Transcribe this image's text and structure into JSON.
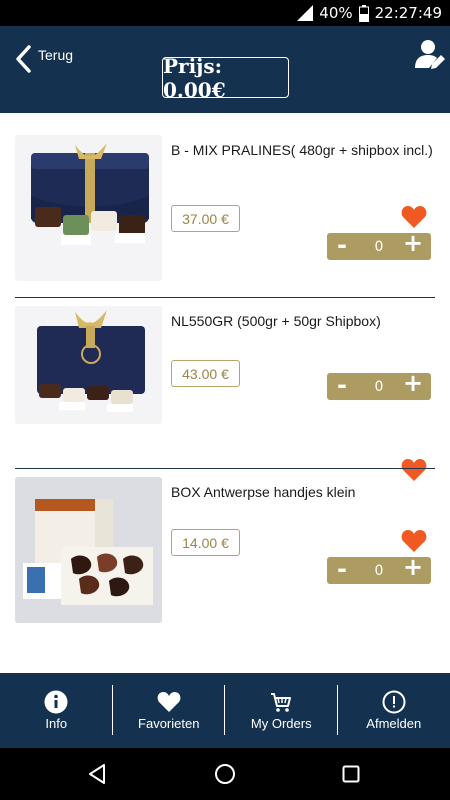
{
  "status": {
    "battery": "40%",
    "time": "22:27:49"
  },
  "header": {
    "back_label": "Terug",
    "price": "Prijs: 0.00€"
  },
  "products": [
    {
      "name": "B - MIX PRALINES( 480gr + shipbox incl.)",
      "price": "37.00 €",
      "qty": "0"
    },
    {
      "name": "NL550GR (500gr + 50gr Shipbox)",
      "price": "43.00 €",
      "qty": "0"
    },
    {
      "name": "BOX Antwerpse handjes klein",
      "price": "14.00 €",
      "qty": "0"
    }
  ],
  "stepper": {
    "minus": "-",
    "plus": "+"
  },
  "tabs": [
    {
      "label": "Info",
      "icon": "info-icon"
    },
    {
      "label": "Favorieten",
      "icon": "heart-icon"
    },
    {
      "label": "My Orders",
      "icon": "cart-icon"
    },
    {
      "label": "Afmelden",
      "icon": "power-icon"
    }
  ],
  "colors": {
    "primary": "#14324f",
    "accent": "#ad9c62",
    "heart": "#f05a22",
    "price_border": "#b8a36b"
  }
}
